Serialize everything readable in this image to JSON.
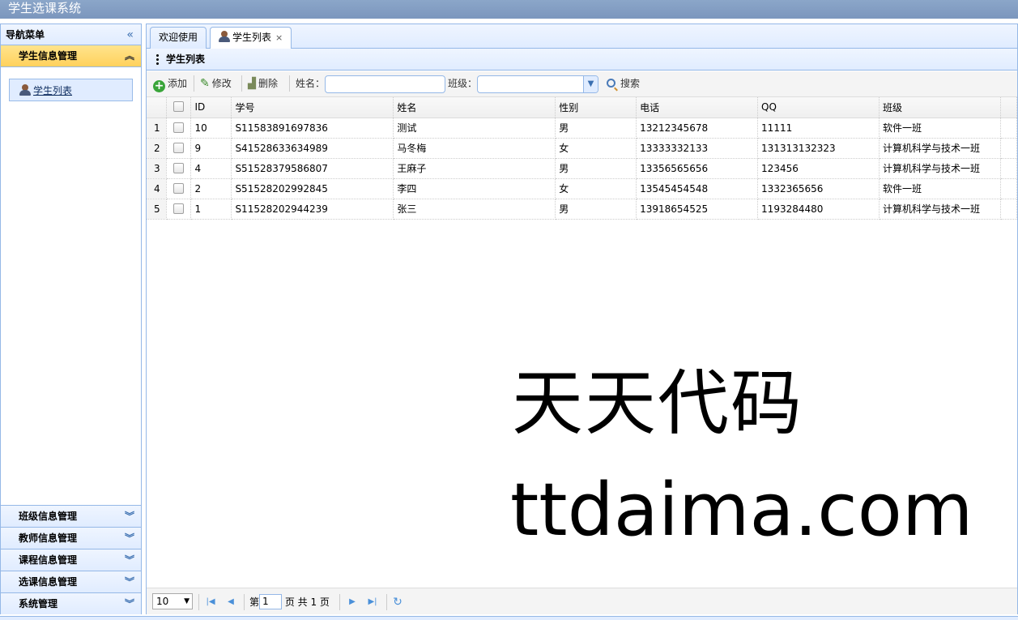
{
  "app": {
    "title": "学生选课系统"
  },
  "nav": {
    "header": "导航菜单",
    "collapse_icon": "double-chevron-left-icon",
    "active_section": "学生信息管理",
    "active_item": "学生列表",
    "sections": [
      "班级信息管理",
      "教师信息管理",
      "课程信息管理",
      "选课信息管理",
      "系统管理"
    ]
  },
  "tabs": [
    {
      "label": "欢迎使用",
      "closable": false,
      "active": false
    },
    {
      "label": "学生列表",
      "closable": true,
      "active": true
    }
  ],
  "panel": {
    "title": "学生列表"
  },
  "toolbar": {
    "add": "添加",
    "edit": "修改",
    "delete": "删除",
    "name_label": "姓名：",
    "name_value": "",
    "class_label": "班级：",
    "class_value": "",
    "search": "搜索"
  },
  "grid": {
    "columns": [
      "ID",
      "学号",
      "姓名",
      "性别",
      "电话",
      "QQ",
      "班级"
    ],
    "rows": [
      {
        "n": "1",
        "id": "10",
        "sn": "S11583891697836",
        "name": "测试",
        "sex": "男",
        "phone": "13212345678",
        "qq": "11111",
        "cls": "软件一班"
      },
      {
        "n": "2",
        "id": "9",
        "sn": "S41528633634989",
        "name": "马冬梅",
        "sex": "女",
        "phone": "13333332133",
        "qq": "131313132323",
        "cls": "计算机科学与技术一班"
      },
      {
        "n": "3",
        "id": "4",
        "sn": "S51528379586807",
        "name": "王麻子",
        "sex": "男",
        "phone": "13356565656",
        "qq": "123456",
        "cls": "计算机科学与技术一班"
      },
      {
        "n": "4",
        "id": "2",
        "sn": "S51528202992845",
        "name": "李四",
        "sex": "女",
        "phone": "13545454548",
        "qq": "1332365656",
        "cls": "软件一班"
      },
      {
        "n": "5",
        "id": "1",
        "sn": "S11528202944239",
        "name": "张三",
        "sex": "男",
        "phone": "13918654525",
        "qq": "1193284480",
        "cls": "计算机科学与技术一班"
      }
    ]
  },
  "pager": {
    "page_size": "10",
    "page_prefix": "第",
    "page_value": "1",
    "page_suffix": "页 共 1 页"
  },
  "watermark": {
    "line1": "天天代码",
    "line2": "ttdaima.com"
  },
  "colors": {
    "accent_blue": "#95b8e7",
    "active_section": "#ffd15c",
    "titlebar": "#7b96bd"
  }
}
